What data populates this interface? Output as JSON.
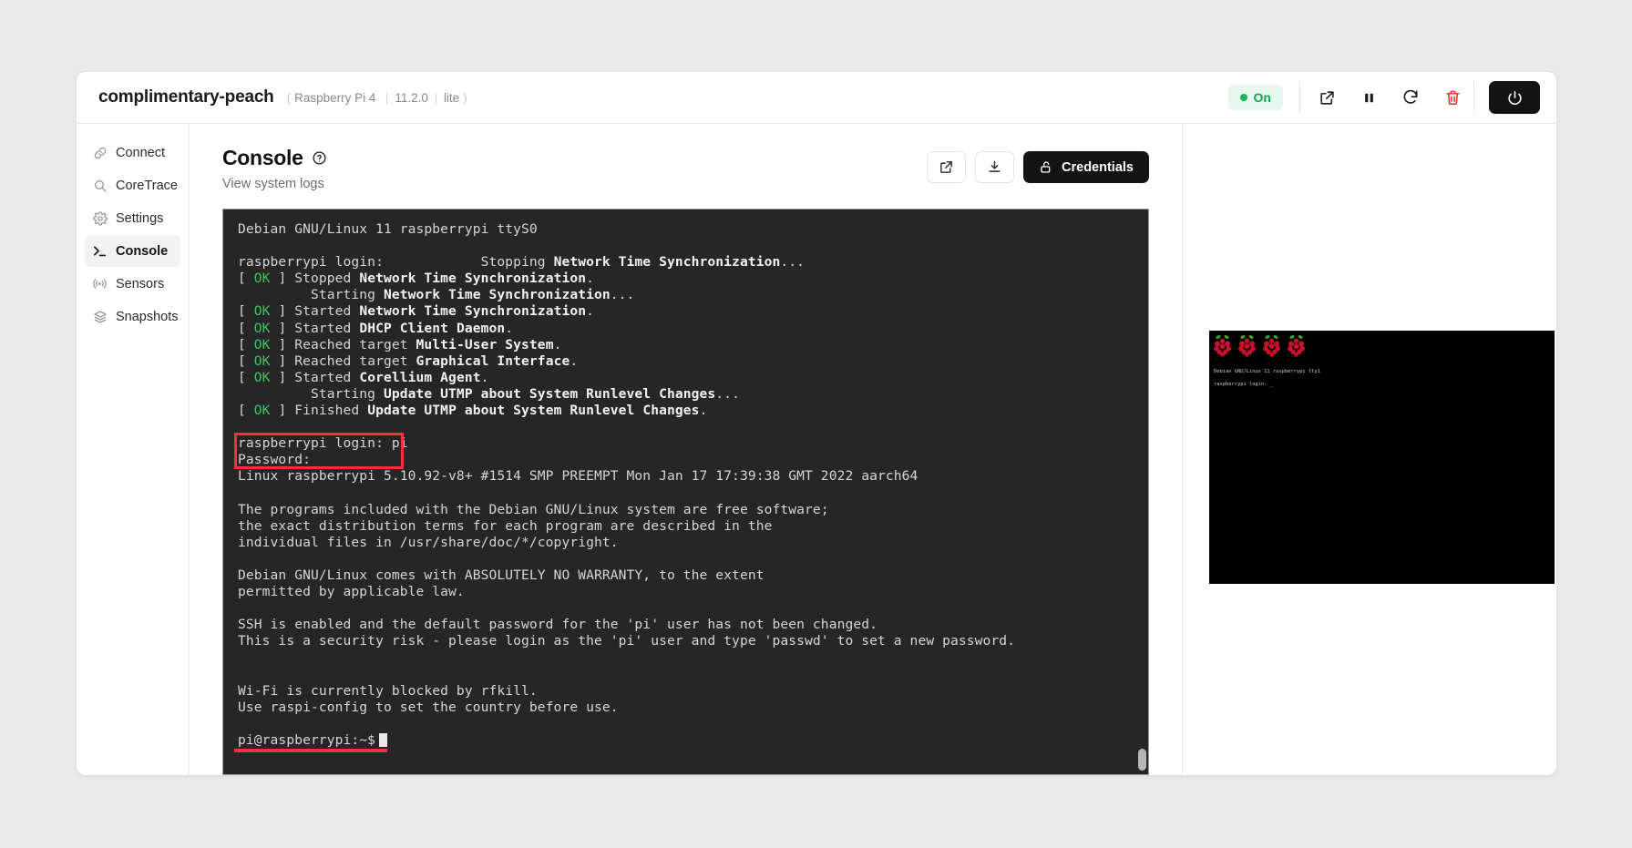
{
  "titlebar": {
    "device_name": "complimentary-peach",
    "meta_open": "(",
    "meta_model": "Raspberry Pi 4",
    "meta_version": "11.2.0",
    "meta_flavor": "lite",
    "meta_close": ")",
    "status_label": "On",
    "status_color": "#12a150",
    "icons": {
      "external": "external-link-icon",
      "pause": "pause-icon",
      "refresh": "refresh-icon",
      "delete": "trash-icon",
      "power": "power-icon"
    },
    "delete_color": "#e53935"
  },
  "sidebar": {
    "items": [
      {
        "label": "Connect",
        "icon": "link-icon",
        "active": false
      },
      {
        "label": "CoreTrace",
        "icon": "search-icon",
        "active": false
      },
      {
        "label": "Settings",
        "icon": "gear-icon",
        "active": false
      },
      {
        "label": "Console",
        "icon": "terminal-icon",
        "active": true
      },
      {
        "label": "Sensors",
        "icon": "signal-icon",
        "active": false
      },
      {
        "label": "Snapshots",
        "icon": "layers-icon",
        "active": false
      }
    ]
  },
  "main": {
    "title": "Console",
    "help_icon": "help-circle-icon",
    "subtitle": "View system logs",
    "actions": {
      "popout_icon": "external-link-icon",
      "download_icon": "download-icon",
      "credentials_label": "Credentials",
      "credentials_icon": "unlock-icon"
    }
  },
  "terminal": {
    "lines": [
      {
        "text": "Debian GNU/Linux 11 raspberrypi ttyS0"
      },
      {
        "text": ""
      },
      {
        "prefix": "raspberrypi login:            Stopping ",
        "bold": "Network Time Synchronization",
        "suffix": "..."
      },
      {
        "ok": true,
        "prefix": "Stopped ",
        "bold": "Network Time Synchronization",
        "suffix": "."
      },
      {
        "indent": true,
        "prefix": "Starting ",
        "bold": "Network Time Synchronization",
        "suffix": "..."
      },
      {
        "ok": true,
        "prefix": "Started ",
        "bold": "Network Time Synchronization",
        "suffix": "."
      },
      {
        "ok": true,
        "prefix": "Started ",
        "bold": "DHCP Client Daemon",
        "suffix": "."
      },
      {
        "ok": true,
        "prefix": "Reached target ",
        "bold": "Multi-User System",
        "suffix": "."
      },
      {
        "ok": true,
        "prefix": "Reached target ",
        "bold": "Graphical Interface",
        "suffix": "."
      },
      {
        "ok": true,
        "prefix": "Started ",
        "bold": "Corellium Agent",
        "suffix": "."
      },
      {
        "indent": true,
        "prefix": "Starting ",
        "bold": "Update UTMP about System Runlevel Changes",
        "suffix": "..."
      },
      {
        "ok": true,
        "prefix": "Finished ",
        "bold": "Update UTMP about System Runlevel Changes",
        "suffix": "."
      },
      {
        "text": ""
      },
      {
        "text": "raspberrypi login: pi"
      },
      {
        "text": "Password:"
      },
      {
        "text": "Linux raspberrypi 5.10.92-v8+ #1514 SMP PREEMPT Mon Jan 17 17:39:38 GMT 2022 aarch64"
      },
      {
        "text": ""
      },
      {
        "text": "The programs included with the Debian GNU/Linux system are free software;"
      },
      {
        "text": "the exact distribution terms for each program are described in the"
      },
      {
        "text": "individual files in /usr/share/doc/*/copyright."
      },
      {
        "text": ""
      },
      {
        "text": "Debian GNU/Linux comes with ABSOLUTELY NO WARRANTY, to the extent"
      },
      {
        "text": "permitted by applicable law."
      },
      {
        "text": ""
      },
      {
        "text": "SSH is enabled and the default password for the 'pi' user has not been changed."
      },
      {
        "text": "This is a security risk - please login as the 'pi' user and type 'passwd' to set a new password."
      },
      {
        "text": ""
      },
      {
        "text": ""
      },
      {
        "text": "Wi-Fi is currently blocked by rfkill."
      },
      {
        "text": "Use raspi-config to set the country before use."
      },
      {
        "text": ""
      },
      {
        "prompt": "pi@raspberrypi:~$"
      }
    ],
    "ok_token": "OK",
    "ok_color": "#3fc463",
    "annotation_color": "#f4313f"
  },
  "preview": {
    "boot_line_1": "Debian GNU/Linux 11 raspberrypi tty1",
    "boot_line_2": "raspberrypi login: _",
    "logo_icon": "raspberry-pi-logo",
    "logo_count": 4
  }
}
